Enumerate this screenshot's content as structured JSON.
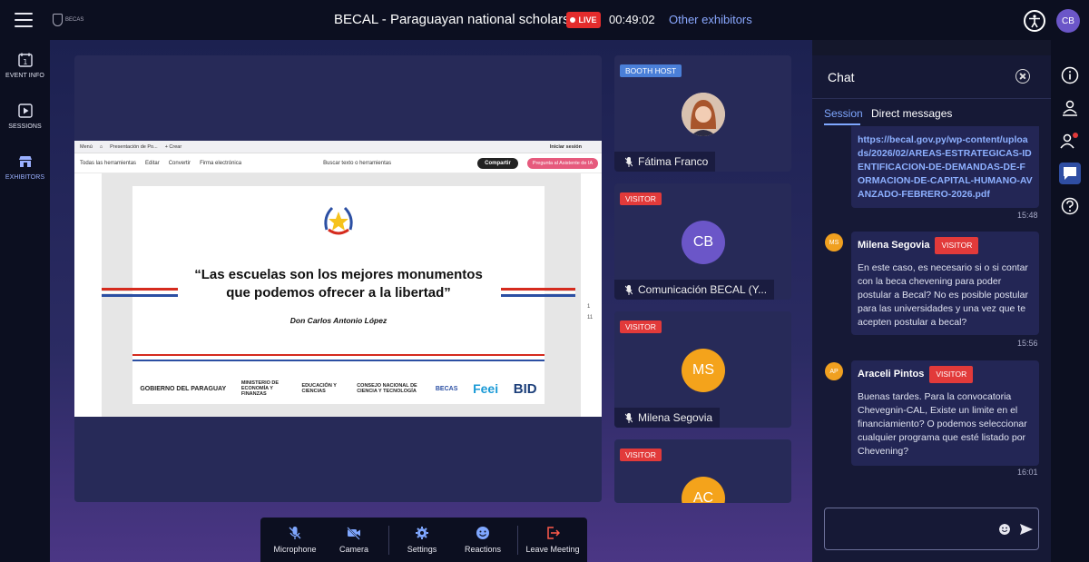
{
  "header": {
    "title": "BECAL - Paraguayan national scholarships",
    "live_label": "LIVE",
    "timer": "00:49:02",
    "other_exhibitors": "Other exhibitors",
    "user_initials": "CB",
    "logo_text": "BECAS"
  },
  "leftnav": {
    "items": [
      {
        "label": "EVENT INFO",
        "icon": "calendar-icon"
      },
      {
        "label": "SESSIONS",
        "icon": "play-icon"
      },
      {
        "label": "EXHIBITORS",
        "icon": "booth-icon",
        "active": true
      }
    ]
  },
  "screen_share": {
    "tab_menu": "Menú",
    "tab_title": "Presentación de Po...",
    "tab_new": "+ Crear",
    "sign_in": "Iniciar sesión",
    "toolbar": [
      "Todas las herramientas",
      "Editar",
      "Convertir",
      "Firma electrónica"
    ],
    "search": "Buscar texto o herramientas",
    "share_button": "Compartir",
    "ai_button": "Pregunta al Asistente de IA",
    "quote_line1": "“Las escuelas son los mejores monumentos",
    "quote_line2": "que podemos ofrecer a la libertad”",
    "author": "Don Carlos Antonio López",
    "logos": [
      "GOBIERNO DEL PARAGUAY",
      "MINISTERIO DE ECONOMÍA Y FINANZAS",
      "EDUCACIÓN Y CIENCIAS",
      "CONSEJO NACIONAL DE CIENCIA Y TECNOLOGÍA",
      "BECAS",
      "Feei",
      "BID"
    ],
    "page_numbers": [
      "1",
      "11"
    ]
  },
  "participants": [
    {
      "tag": "BOOTH HOST",
      "name": "Fátima Franco",
      "initials": "",
      "color": "#c98e6a"
    },
    {
      "tag": "VISITOR",
      "name": "Comunicación BECAL (Y...",
      "initials": "CB",
      "color": "#6b56c8"
    },
    {
      "tag": "VISITOR",
      "name": "Milena Segovia",
      "initials": "MS",
      "color": "#f4a31b"
    },
    {
      "tag": "VISITOR",
      "name": "",
      "initials": "AC",
      "color": "#f4a31b"
    }
  ],
  "controls": [
    {
      "label": "Microphone",
      "icon": "mic-off-icon"
    },
    {
      "label": "Camera",
      "icon": "camera-off-icon"
    },
    {
      "label": "Settings",
      "icon": "gear-icon"
    },
    {
      "label": "Reactions",
      "icon": "smile-icon"
    },
    {
      "label": "Leave Meeting",
      "icon": "leave-icon"
    }
  ],
  "chat": {
    "title": "Chat",
    "tabs": [
      "Session",
      "Direct messages"
    ],
    "link_message": {
      "text": "https://becal.gov.py/wp-content/uploads/2026/02/AREAS-ESTRATEGICAS-IDENTIFICACION-DE-DEMANDAS-DE-FORMACION-DE-CAPITAL-HUMANO-AVANZADO-FEBRERO-2026.pdf",
      "time": "15:48"
    },
    "messages": [
      {
        "initials": "MS",
        "name": "Milena Segovia",
        "tag": "VISITOR",
        "text": "En este caso, es necesario si o si contar con la beca chevening para poder postular a Becal? No es posible postular para las universidades y una vez que te acepten postular a becal?",
        "time": "15:56"
      },
      {
        "initials": "AP",
        "name": "Araceli Pintos",
        "tag": "VISITOR",
        "text": "Buenas tardes. Para la convocatoria Chevegnin-CAL, Existe un limite en el financiamiento? O podemos seleccionar cualquier programa que esté listado por Chevening?",
        "time": "16:01"
      }
    ],
    "input_placeholder": ""
  }
}
